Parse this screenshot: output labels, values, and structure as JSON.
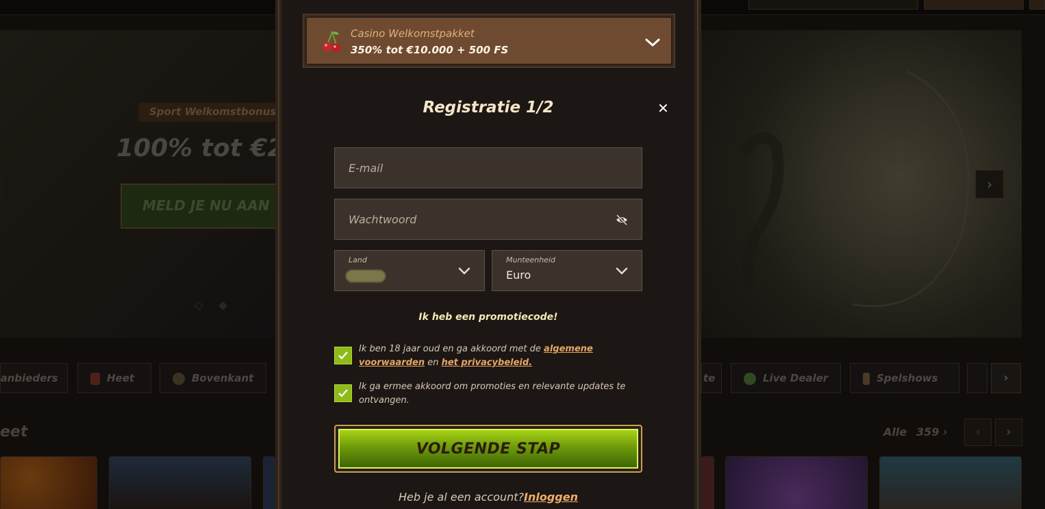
{
  "background": {
    "hero": {
      "badge": "Sport Welkomstbonus",
      "title": "100% tot €2",
      "cta": "MELD JE NU AAN"
    },
    "categories": [
      "Aanbieders",
      "Heet",
      "Bovenkant",
      "te",
      "Live Dealer",
      "Spelshows"
    ],
    "section_title": "eet",
    "all_label": "Alle",
    "count": "359"
  },
  "modal": {
    "promo": {
      "label": "Casino Welkomstpakket",
      "value": "350% tot €10.000 + 500 FS",
      "icon": "cherry-icon"
    },
    "title": "Registratie 1/2",
    "close_icon": "close-icon",
    "email": {
      "placeholder": "E-mail",
      "value": ""
    },
    "password": {
      "placeholder": "Wachtwoord",
      "value": ""
    },
    "country": {
      "label": "Land",
      "value": ""
    },
    "currency": {
      "label": "Munteenheid",
      "value": "Euro"
    },
    "promo_code_link": "Ik heb een promotiecode!",
    "terms": {
      "checked": true,
      "text_before": "Ik ben 18 jaar oud en ga akkoord met de ",
      "terms_link": "algemene voorwaarden",
      "text_middle": " en ",
      "privacy_link": "het privacybeleid."
    },
    "marketing": {
      "checked": true,
      "text": "Ik ga ermee akkoord om promoties en relevante updates te ontvangen."
    },
    "next_button": "VOLGENDE STAP",
    "login_prompt": "Heb je al een account?",
    "login_link": "Inloggen"
  },
  "colors": {
    "accent_green": "#8dbb1a",
    "promo_bg": "#6e4b30",
    "modal_bg": "#1c1714",
    "link_orange": "#e9a565"
  }
}
